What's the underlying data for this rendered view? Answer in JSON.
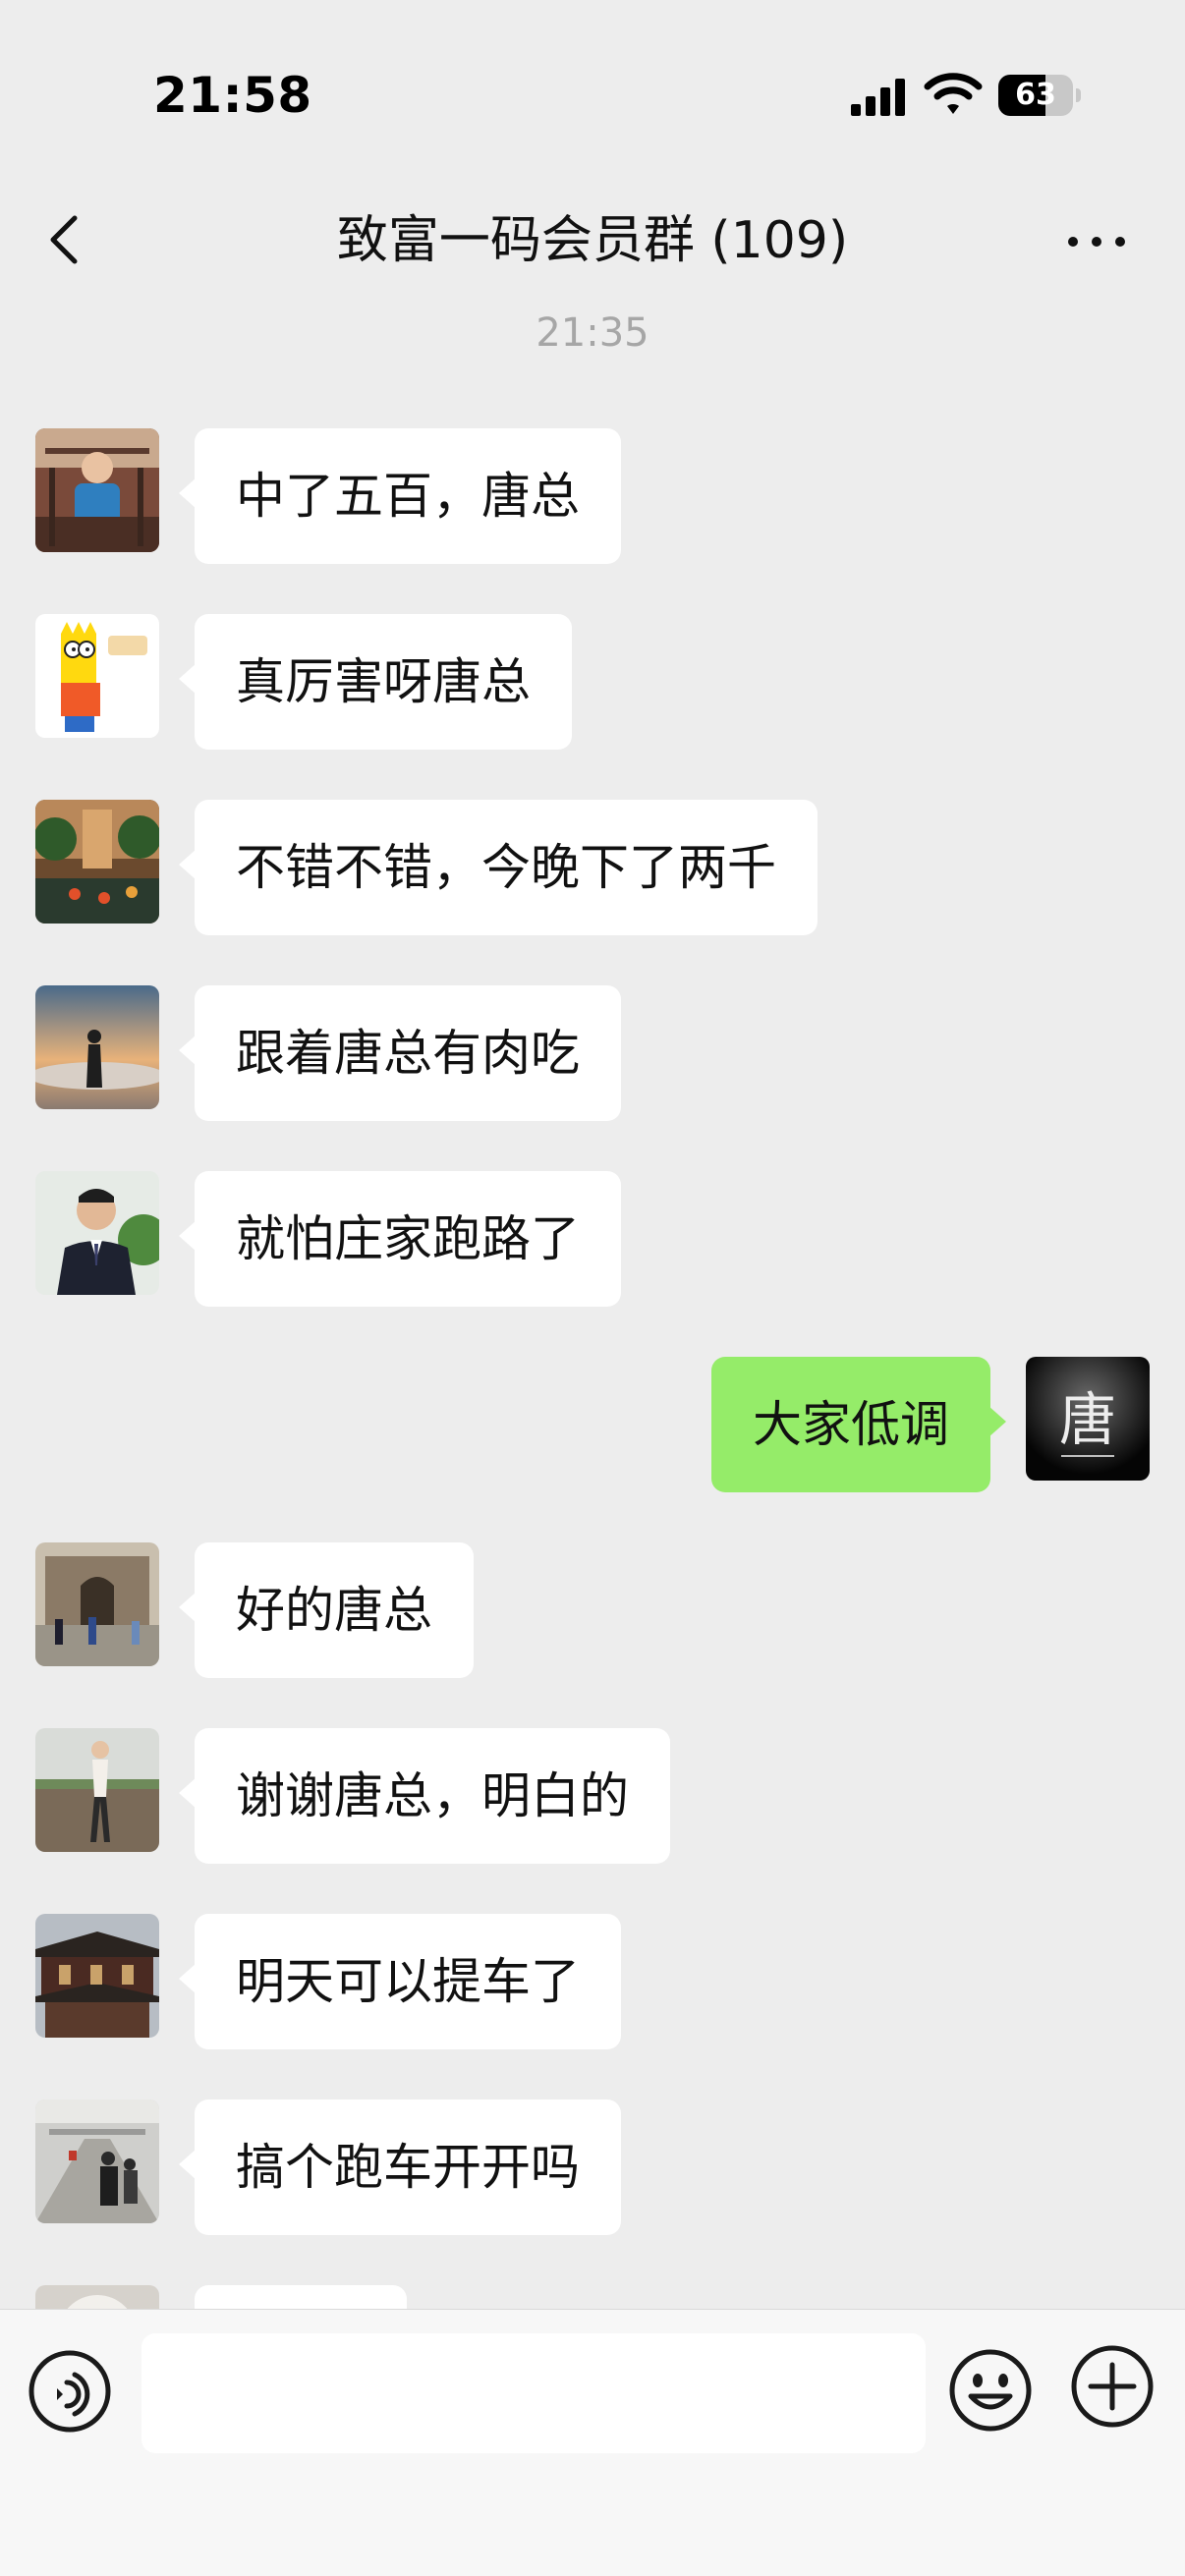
{
  "status_bar": {
    "time": "21:58",
    "battery_label": "63",
    "battery_level": 0.63,
    "icons": [
      "signal-icon",
      "wifi-icon",
      "battery-icon"
    ]
  },
  "nav": {
    "title": "致富一码会员群 (109)",
    "back_icon": "chevron-left-icon",
    "more_icon": "more-dots-icon"
  },
  "chat": {
    "time_divider": "21:35",
    "messages": [
      {
        "direction": "incoming",
        "text": "中了五百，唐总",
        "avatar": "child-photo-avatar"
      },
      {
        "direction": "incoming",
        "text": "真厉害呀唐总",
        "avatar": "cartoon-avatar"
      },
      {
        "direction": "incoming",
        "text": "不错不错，今晚下了两千",
        "avatar": "garden-photo-avatar"
      },
      {
        "direction": "incoming",
        "text": "跟着唐总有肉吃",
        "avatar": "sunset-silhouette-avatar"
      },
      {
        "direction": "incoming",
        "text": "就怕庄家跑路了",
        "avatar": "man-in-suit-avatar"
      },
      {
        "direction": "outgoing",
        "text": "大家低调",
        "avatar": "tang-logo-avatar",
        "avatar_text": "唐"
      },
      {
        "direction": "incoming",
        "text": "好的唐总",
        "avatar": "building-street-avatar"
      },
      {
        "direction": "incoming",
        "text": "谢谢唐总，明白的",
        "avatar": "woman-field-avatar"
      },
      {
        "direction": "incoming",
        "text": "明天可以提车了",
        "avatar": "chinese-building-avatar"
      },
      {
        "direction": "incoming",
        "text": "搞个跑车开开吗",
        "avatar": "station-corridor-avatar"
      },
      {
        "direction": "incoming",
        "text": "",
        "avatar": "partial-avatar"
      }
    ]
  },
  "input_bar": {
    "placeholder": "",
    "voice_icon": "voice-icon",
    "emoji_icon": "emoji-icon",
    "plus_icon": "plus-circle-icon"
  },
  "colors": {
    "background": "#EDEDED",
    "incoming_bubble": "#FFFFFF",
    "outgoing_bubble": "#95EC69",
    "time_divider": "#A6A6A6",
    "input_bar": "#F7F7F7"
  }
}
